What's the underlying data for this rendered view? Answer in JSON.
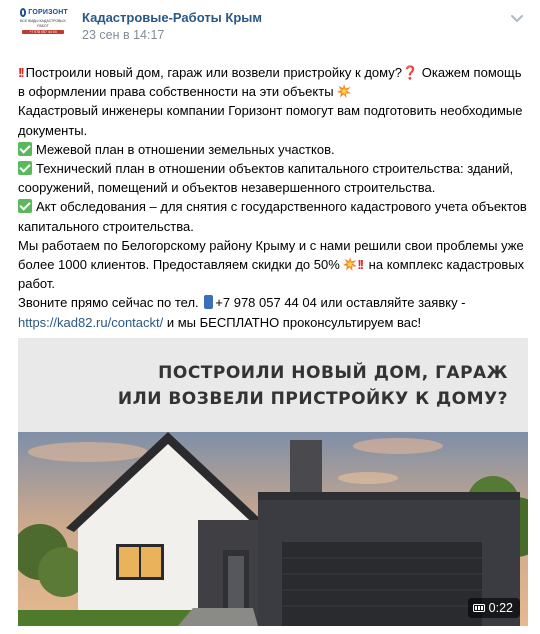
{
  "post": {
    "author": "Кадастровые-Работы Крым",
    "date": "23 сен в 14:17",
    "avatar": {
      "logo_text": "ГОРИЗОНТ",
      "logo_sub": "ВСЕ ВИДЫ КАДАСТРОВЫХ РАБОТ",
      "logo_phone": "+7 978 057 44 04"
    },
    "lines": {
      "l1": "Построили новый дом, гараж или возвели пристройку к дому?",
      "l1b": " Окажем помощь в оформлении права собственности на эти объекты",
      "l2": "Кадастровый инженеры компании Горизонт помогут вам подготовить необходимые документы.",
      "l3": "Межевой план в отношении земельных участков.",
      "l4": "Технический план в отношении объектов капитального строительства: зданий, сооружений, помещений и объектов незавершенного строительства.",
      "l5": "Акт обследования – для снятия с государственного кадастрового учета объектов капитального строительства.",
      "l6a": "Мы работаем по Белогорскому району Крыму и с нами решили свои проблемы уже более 1000 клиентов. Предоставляем скидки до 50%",
      "l6b": " на комплекс кадастровых работ.",
      "l7a": "Звоните прямо сейчас по тел. ",
      "l7b": "+7 978 057 44 04 или оставляйте заявку -",
      "link": "https://kad82.ru/contackt/",
      "l8": " и мы БЕСПЛАТНО проконсультируем вас!"
    },
    "media": {
      "title_line1": "ПОСТРОИЛИ НОВЫЙ ДОМ, ГАРАЖ",
      "title_line2": "ИЛИ ВОЗВЕЛИ ПРИСТРОЙКУ К ДОМУ?",
      "duration": "0:22"
    }
  },
  "colors": {
    "link": "#2a5885",
    "date": "#818c99",
    "emoji_red": "#e02424",
    "check_green": "#5cb85c"
  },
  "icons": [
    "double-exclamation-icon",
    "question-icon",
    "collision-icon",
    "check-mark-icon",
    "phone-icon",
    "chevron-down-icon",
    "video-icon"
  ]
}
